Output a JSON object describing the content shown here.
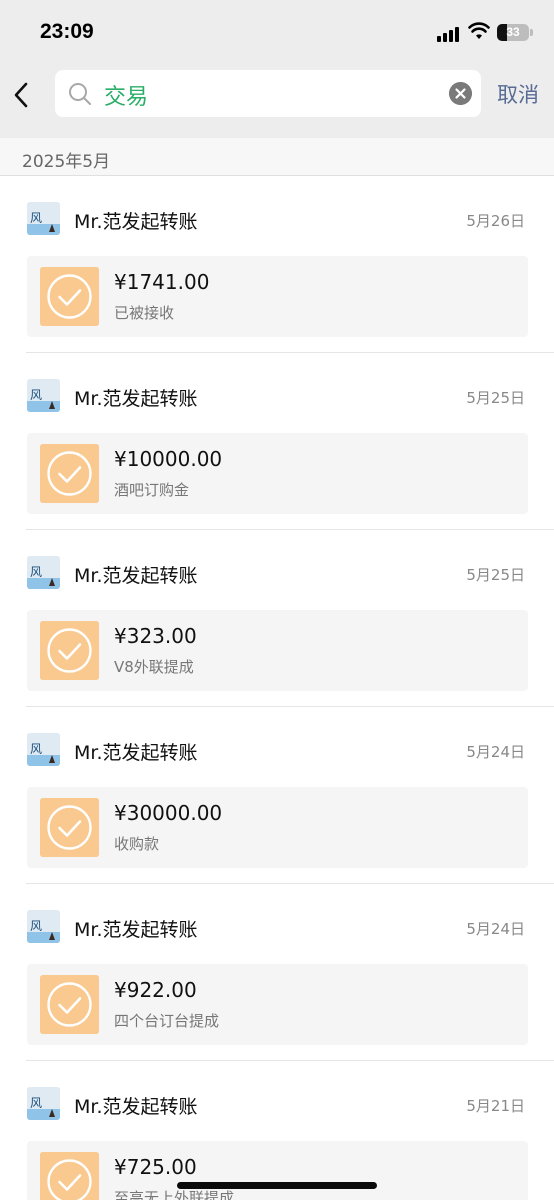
{
  "status": {
    "time": "23:09",
    "battery": "33"
  },
  "search": {
    "query": "交易",
    "cancel_label": "取消"
  },
  "section": {
    "title": "2025年5月"
  },
  "transfers": [
    {
      "sender": "Mr.范发起转账",
      "date": "5月26日",
      "amount": "¥1741.00",
      "note": "已被接收"
    },
    {
      "sender": "Mr.范发起转账",
      "date": "5月25日",
      "amount": "¥10000.00",
      "note": "酒吧订购金"
    },
    {
      "sender": "Mr.范发起转账",
      "date": "5月25日",
      "amount": "¥323.00",
      "note": "V8外联提成"
    },
    {
      "sender": "Mr.范发起转账",
      "date": "5月24日",
      "amount": "¥30000.00",
      "note": "收购款"
    },
    {
      "sender": "Mr.范发起转账",
      "date": "5月24日",
      "amount": "¥922.00",
      "note": "四个台订台提成"
    },
    {
      "sender": "Mr.范发起转账",
      "date": "5月21日",
      "amount": "¥725.00",
      "note": "至高无上外联提成"
    }
  ],
  "colors": {
    "accent": "#2aae67",
    "link": "#576b95",
    "transfer_icon": "#f9c98f"
  }
}
